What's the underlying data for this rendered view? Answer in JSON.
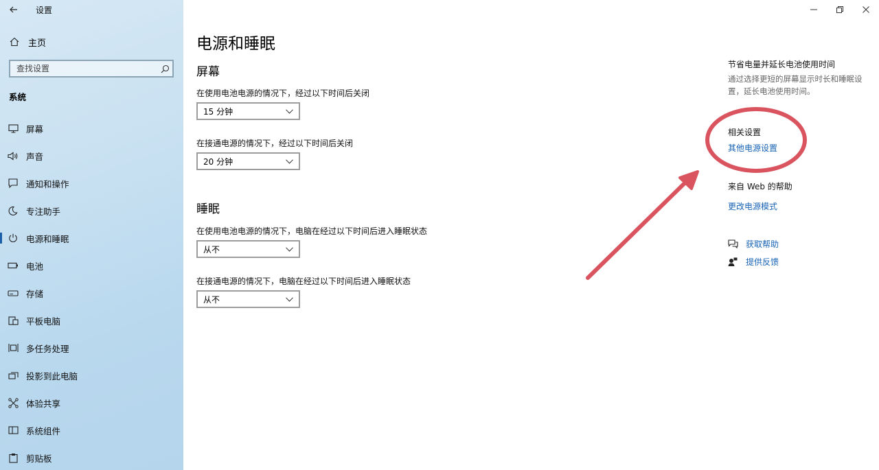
{
  "app": {
    "title": "设置"
  },
  "window_controls": {
    "minimize": "minimize-icon",
    "restore": "restore-icon",
    "close": "close-icon"
  },
  "sidebar": {
    "home_label": "主页",
    "search_placeholder": "查找设置",
    "section": "系统",
    "items": [
      {
        "label": "屏幕",
        "icon": "monitor-icon"
      },
      {
        "label": "声音",
        "icon": "speaker-icon"
      },
      {
        "label": "通知和操作",
        "icon": "notification-icon"
      },
      {
        "label": "专注助手",
        "icon": "moon-icon"
      },
      {
        "label": "电源和睡眠",
        "icon": "power-icon",
        "active": true
      },
      {
        "label": "电池",
        "icon": "battery-icon"
      },
      {
        "label": "存储",
        "icon": "storage-icon"
      },
      {
        "label": "平板电脑",
        "icon": "tablet-icon"
      },
      {
        "label": "多任务处理",
        "icon": "multitask-icon"
      },
      {
        "label": "投影到此电脑",
        "icon": "project-icon"
      },
      {
        "label": "体验共享",
        "icon": "share-icon"
      },
      {
        "label": "系统组件",
        "icon": "components-icon"
      },
      {
        "label": "剪贴板",
        "icon": "clipboard-icon"
      }
    ]
  },
  "main": {
    "title": "电源和睡眠",
    "screen": {
      "heading": "屏幕",
      "battery_label": "在使用电池电源的情况下，经过以下时间后关闭",
      "battery_value": "15 分钟",
      "plugged_label": "在接通电源的情况下，经过以下时间后关闭",
      "plugged_value": "20 分钟"
    },
    "sleep": {
      "heading": "睡眠",
      "battery_label": "在使用电池电源的情况下，电脑在经过以下时间后进入睡眠状态",
      "battery_value": "从不",
      "plugged_label": "在接通电源的情况下，电脑在经过以下时间后进入睡眠状态",
      "plugged_value": "从不"
    }
  },
  "right": {
    "save_title": "节省电量并延长电池使用时间",
    "save_desc": "通过选择更短的屏幕显示时长和睡眠设置，延长电池使用时间。",
    "related_title": "相关设置",
    "related_link": "其他电源设置",
    "web_help_title": "来自 Web 的帮助",
    "web_help_link": "更改电源模式",
    "get_help": "获取帮助",
    "feedback": "提供反馈"
  },
  "annotation": {
    "color": "#d9545f"
  }
}
